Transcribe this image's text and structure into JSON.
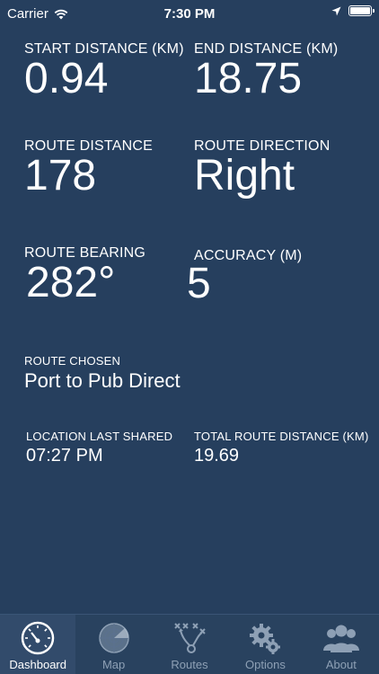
{
  "status_bar": {
    "carrier": "Carrier",
    "time": "7:30 PM"
  },
  "metrics": {
    "start_distance": {
      "label": "START DISTANCE (KM)",
      "value": "0.94"
    },
    "end_distance": {
      "label": "END DISTANCE (KM)",
      "value": "18.75"
    },
    "route_distance": {
      "label": "ROUTE DISTANCE",
      "value": "178"
    },
    "route_direction": {
      "label": "ROUTE DIRECTION",
      "value": "Right"
    },
    "route_bearing": {
      "label": "ROUTE BEARING",
      "value": "282°"
    },
    "accuracy": {
      "label": "ACCURACY (M)",
      "value": "5"
    },
    "route_chosen": {
      "label": "ROUTE CHOSEN",
      "value": "Port to Pub Direct"
    },
    "location_last_shared": {
      "label": "LOCATION LAST SHARED",
      "value": "07:27 PM"
    },
    "total_route_distance": {
      "label": "TOTAL ROUTE DISTANCE (KM)",
      "value": "19.69"
    }
  },
  "tabs": [
    {
      "label": "Dashboard",
      "icon": "speedometer-icon",
      "active": true
    },
    {
      "label": "Map",
      "icon": "radar-icon",
      "active": false
    },
    {
      "label": "Routes",
      "icon": "play-diagram-icon",
      "active": false
    },
    {
      "label": "Options",
      "icon": "gears-icon",
      "active": false
    },
    {
      "label": "About",
      "icon": "people-icon",
      "active": false
    }
  ],
  "colors": {
    "background": "#263f5e",
    "tab_bar": "#29425f",
    "text": "#ffffff",
    "inactive_tab": "#8ea0b5"
  }
}
